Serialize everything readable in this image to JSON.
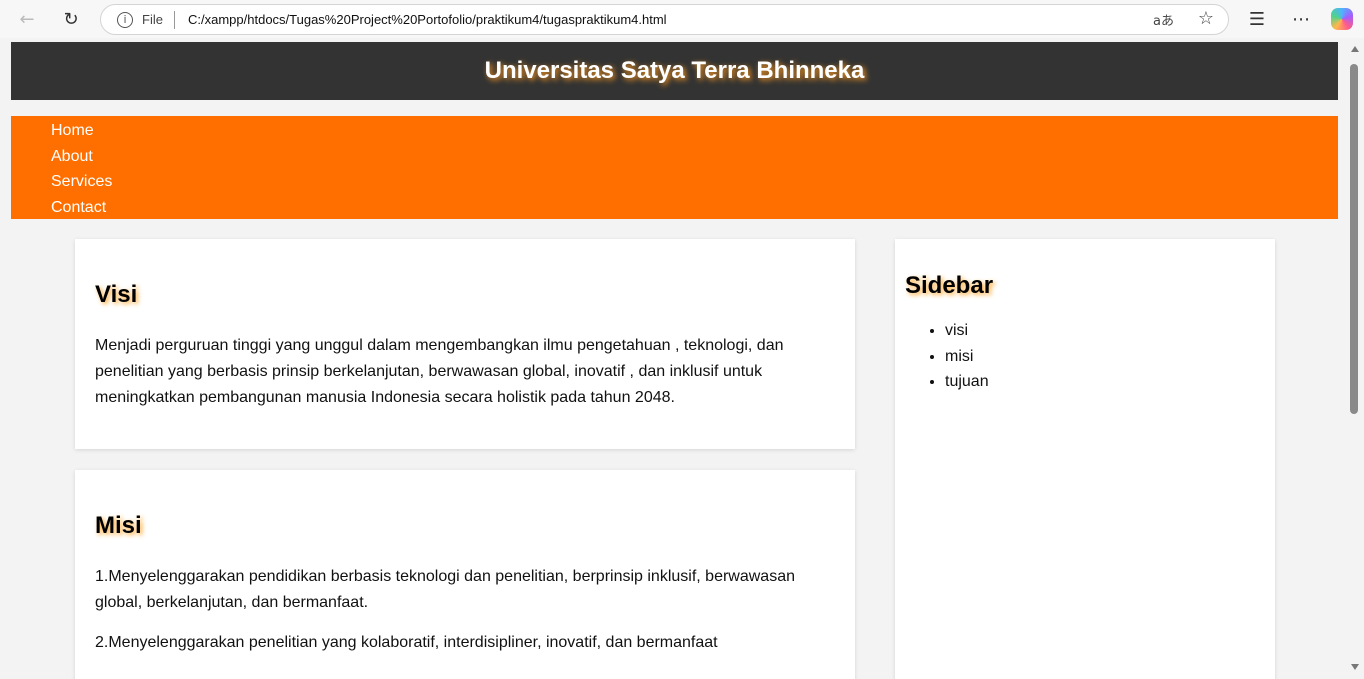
{
  "browser": {
    "file_label": "File",
    "url": "C:/xampp/htdocs/Tugas%20Project%20Portofolio/praktikum4/tugaspraktikum4.html",
    "read_aloud_glyph": "aあ"
  },
  "site": {
    "title": "Universitas Satya Terra Bhinneka",
    "header_bg": "#333333",
    "nav_bg": "#ff6f00",
    "nav": [
      {
        "label": "Home"
      },
      {
        "label": "About"
      },
      {
        "label": "Services"
      },
      {
        "label": "Contact"
      }
    ]
  },
  "visi": {
    "heading": "Visi",
    "text": "Menjadi perguruan tinggi yang unggul dalam mengembangkan ilmu pengetahuan , teknologi, dan penelitian yang berbasis prinsip berkelanjutan, berwawasan global, inovatif , dan inklusif untuk meningkatkan pembangunan manusia Indonesia secara holistik pada tahun 2048."
  },
  "misi": {
    "heading": "Misi",
    "items": [
      "1.Menyelenggarakan pendidikan berbasis teknologi dan penelitian, berprinsip inklusif, berwawasan global, berkelanjutan, dan bermanfaat.",
      "2.Menyelenggarakan penelitian yang kolaboratif, interdisipliner, inovatif, dan bermanfaat"
    ]
  },
  "sidebar": {
    "heading": "Sidebar",
    "items": [
      "visi",
      "misi",
      "tujuan"
    ]
  }
}
